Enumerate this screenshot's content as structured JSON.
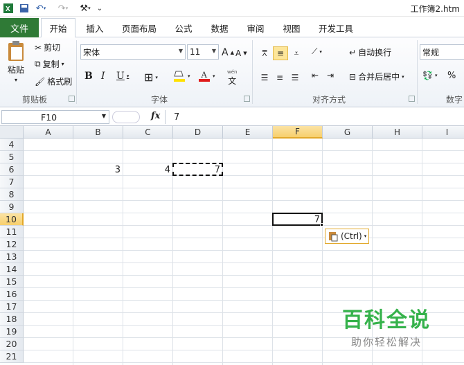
{
  "window": {
    "title": "工作簿2.htm"
  },
  "tabs": [
    "文件",
    "开始",
    "插入",
    "页面布局",
    "公式",
    "数据",
    "审阅",
    "视图",
    "开发工具"
  ],
  "ribbon": {
    "clipboard": {
      "paste": "粘贴",
      "cut": "剪切",
      "copy": "复制",
      "format_painter": "格式刷",
      "label": "剪贴板"
    },
    "font": {
      "name": "宋体",
      "size": "11",
      "label": "字体",
      "bold": "B",
      "italic": "I",
      "underline": "U",
      "phonetic": "文"
    },
    "alignment": {
      "wrap": "自动换行",
      "merge": "合并后居中",
      "label": "对齐方式"
    },
    "number": {
      "format": "常规",
      "percent": "%",
      "label": "数字"
    }
  },
  "formula_bar": {
    "name_box": "F10",
    "fx": "fx",
    "value": "7"
  },
  "columns": [
    "A",
    "B",
    "C",
    "D",
    "E",
    "F",
    "G",
    "H",
    "I"
  ],
  "rows": [
    "4",
    "5",
    "6",
    "7",
    "8",
    "9",
    "10",
    "11",
    "12",
    "13",
    "14",
    "15",
    "16",
    "17",
    "18",
    "19",
    "20",
    "21"
  ],
  "selected": {
    "column": "F",
    "row": "10"
  },
  "cells": {
    "B6": "3",
    "C6": "4",
    "D6": "7",
    "F10": "7"
  },
  "paste_options": {
    "label": "(Ctrl)"
  },
  "watermark": {
    "title": "百科全说",
    "subtitle": "助你轻松解决"
  }
}
